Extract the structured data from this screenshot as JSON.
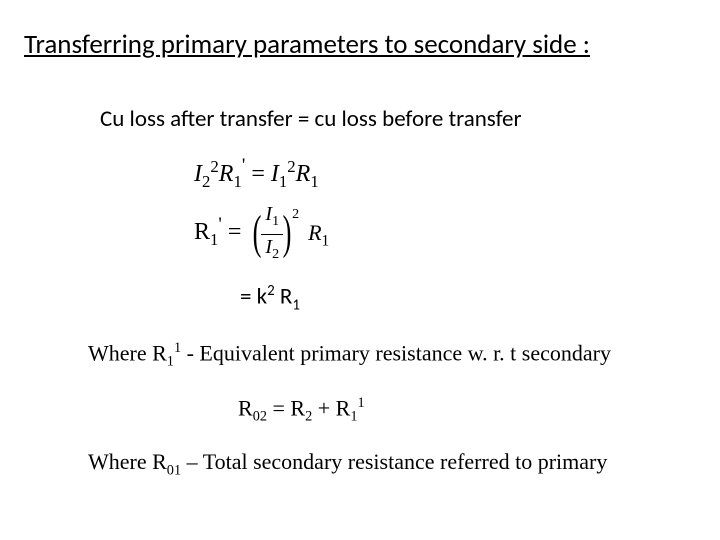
{
  "title": "Transferring primary parameters to secondary side :",
  "cu_statement": "Cu loss after  transfer = cu loss before transfer",
  "eq1": {
    "lhs_I": "I",
    "lhs_I_sub": "2",
    "lhs_I_sup": "2",
    "lhs_R": "R",
    "lhs_R_sub": "1",
    "lhs_R_prime": "'",
    "eq": " = ",
    "rhs_I": "I",
    "rhs_I_sub": "1",
    "rhs_I_sup": "2",
    "rhs_R": "R",
    "rhs_R_sub": "1"
  },
  "eq2": {
    "lhs_R": "R",
    "lhs_R_sub": "1",
    "lhs_R_prime": "'",
    "eq": " = ",
    "num_I": "I",
    "num_sub": "1",
    "den_I": "I",
    "den_sub": "2",
    "outer_exp": "2",
    "rhs_R": "R",
    "rhs_R_sub": "1"
  },
  "eq3": {
    "text_eq": "=  k",
    "k_exp": "2",
    "space": " R",
    "r_sub": "1"
  },
  "where1": {
    "pre": "Where R",
    "sub": "1",
    "sup": "1",
    "post": " - Equivalent primary resistance w. r. t secondary"
  },
  "eq4": {
    "R02": "R",
    "R02_sub": "02",
    "eq": " = R",
    "R2_sub": "2",
    "plus": " + R",
    "R11_sub": "1",
    "R11_sup": "1"
  },
  "where2": {
    "pre": "Where R",
    "sub": "01",
    "post": " – Total secondary resistance  referred to primary"
  }
}
